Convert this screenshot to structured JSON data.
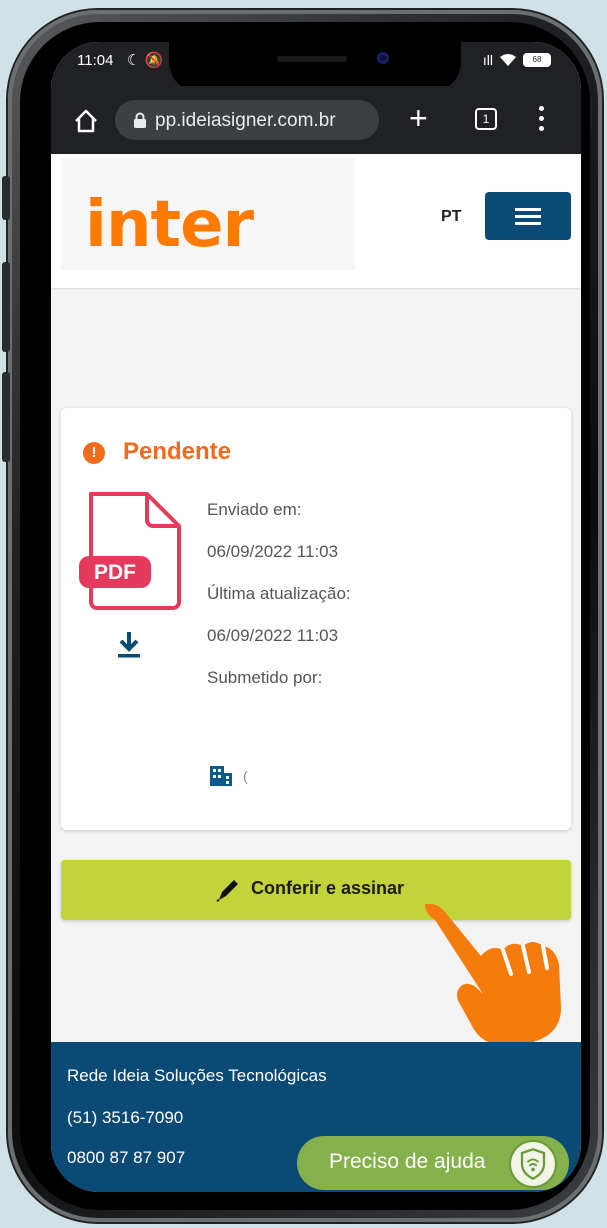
{
  "status_bar": {
    "time": "11:04",
    "left_icons": "☾ 🔕",
    "signal": "ıll",
    "battery": "68"
  },
  "browser": {
    "url": "pp.ideiasigner.com.br",
    "tab_count": "1"
  },
  "header": {
    "logo": "inter",
    "language": "PT"
  },
  "document_card": {
    "status": "Pendente",
    "file_type": "PDF",
    "sent_label": "Enviado em:",
    "sent_value": "06/09/2022 11:03",
    "updated_label": "Última atualização:",
    "updated_value": "06/09/2022 11:03",
    "submitted_label": "Submetido por:",
    "submitter_partial": "("
  },
  "actions": {
    "sign_label": "Conferir e assinar"
  },
  "footer": {
    "company": "Rede Ideia Soluções Tecnológicas",
    "phone": "(51) 3516-7090",
    "toll_free": "0800 87 87 907",
    "help_label": "Preciso de ajuda"
  },
  "colors": {
    "brand_orange": "#ff7a00",
    "status_orange": "#f26a1b",
    "navy": "#0a4a75",
    "sign_green": "#c3d43a",
    "help_green": "#84b14b",
    "pdf_red": "#e53a5b"
  }
}
